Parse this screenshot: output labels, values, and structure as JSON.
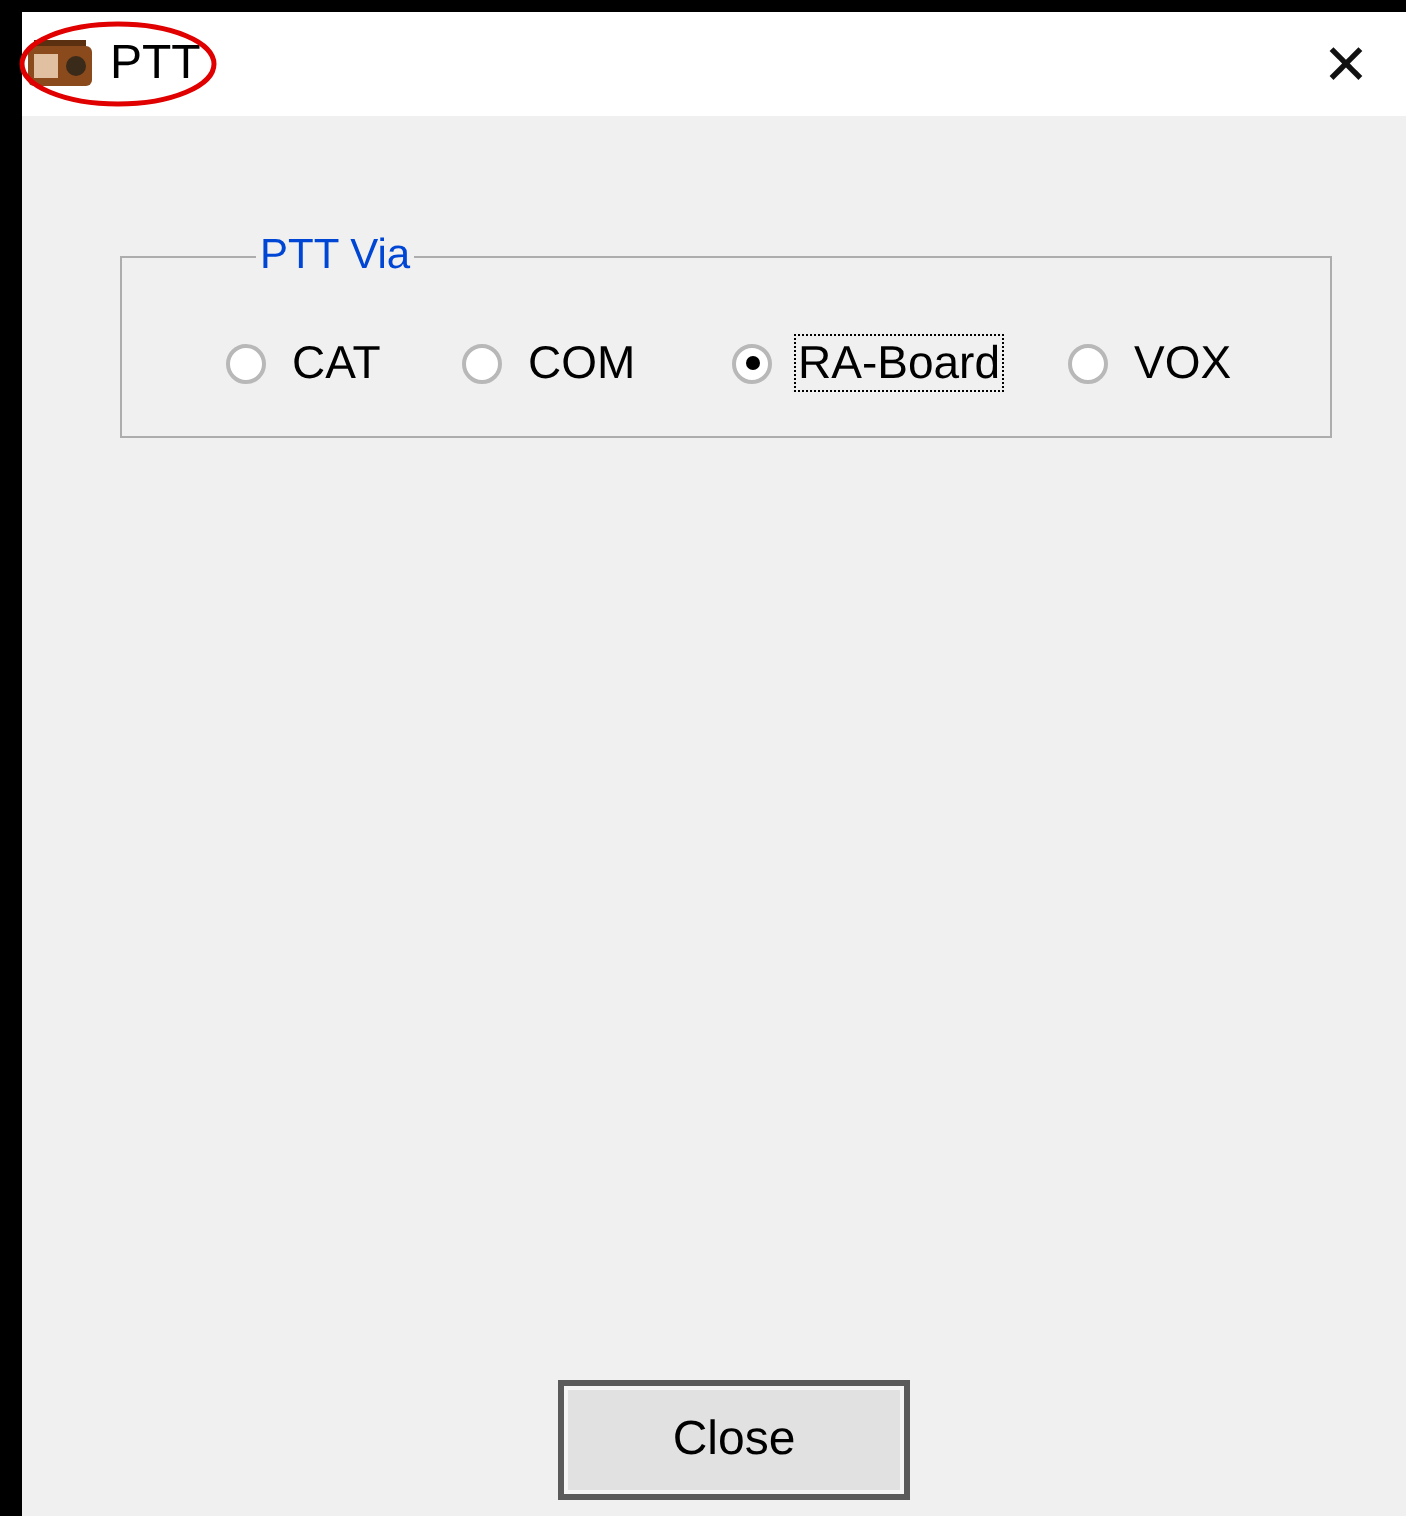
{
  "window": {
    "title": "PTT",
    "close_glyph": "✕"
  },
  "ptt_via": {
    "legend": "PTT Via",
    "options": [
      {
        "label": "CAT",
        "selected": false,
        "focused": false
      },
      {
        "label": "COM",
        "selected": false,
        "focused": false
      },
      {
        "label": "RA-Board",
        "selected": true,
        "focused": true
      },
      {
        "label": "VOX",
        "selected": false,
        "focused": false
      }
    ]
  },
  "buttons": [
    {
      "label": "Close"
    }
  ]
}
